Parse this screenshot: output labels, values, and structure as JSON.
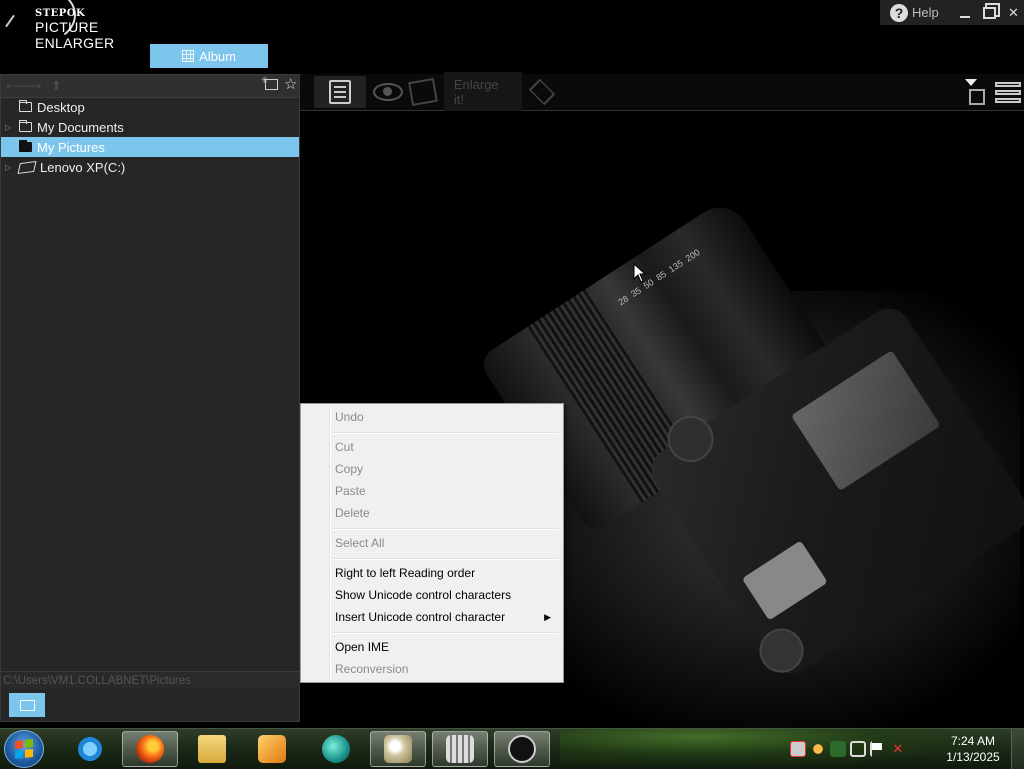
{
  "app": {
    "logo_top": "STEPOK",
    "logo_bottom": "PICTURE ENLARGER",
    "album_label": "Album",
    "help_label": "Help"
  },
  "left_panel": {
    "tree": [
      {
        "label": "Desktop",
        "expandable": false,
        "selected": false,
        "icon": "folder-icon"
      },
      {
        "label": "My Documents",
        "expandable": true,
        "selected": false,
        "icon": "folder-icon"
      },
      {
        "label": "My Pictures",
        "expandable": false,
        "selected": true,
        "icon": "folder-icon"
      },
      {
        "label": "Lenovo XP(C:)",
        "expandable": true,
        "selected": false,
        "icon": "drive-icon"
      }
    ],
    "path": "C:\\Users\\VM1.COLLABNET\\Pictures"
  },
  "toolbar": {
    "enlarge_label": "Enlarge it!"
  },
  "context_menu": {
    "items": [
      {
        "label": "Undo",
        "accel": "U",
        "rest": "ndo",
        "disabled": true
      },
      {
        "label": "Cut",
        "accel": "t",
        "pre": "Cu",
        "disabled": true
      },
      {
        "label": "Copy",
        "accel": "C",
        "rest": "opy",
        "disabled": true
      },
      {
        "label": "Paste",
        "accel": "P",
        "rest": "aste",
        "disabled": true
      },
      {
        "label": "Delete",
        "accel": "D",
        "rest": "elete",
        "disabled": true
      },
      {
        "label": "Select All",
        "accel": "A",
        "pre": "Select ",
        "rest": "ll",
        "disabled": true
      },
      {
        "label": "Right to left Reading order",
        "accel": "R",
        "rest": "ight to left Reading order",
        "disabled": false
      },
      {
        "label": "Show Unicode control characters",
        "accel": "S",
        "rest": "how Unicode control characters",
        "disabled": false
      },
      {
        "label": "Insert Unicode control character",
        "accel": "I",
        "rest": "nsert Unicode control character",
        "disabled": false,
        "submenu": true
      },
      {
        "label": "Open IME",
        "accel": "O",
        "rest": "pen IME",
        "disabled": false
      },
      {
        "label": "Reconversion",
        "accel": "R",
        "rest": "econversion",
        "disabled": true
      }
    ]
  },
  "photo": {
    "lens_numbers": [
      "28",
      "35",
      "50",
      "85",
      "135",
      "200"
    ]
  },
  "taskbar": {
    "apps": [
      {
        "name": "internet-explorer",
        "active": false,
        "color": "#1f86d6"
      },
      {
        "name": "firefox",
        "active": true,
        "color": "#ff7a18"
      },
      {
        "name": "file-explorer",
        "active": false,
        "color": "#e8c54a"
      },
      {
        "name": "media-player",
        "active": false,
        "color": "#f0a020"
      },
      {
        "name": "media-globe",
        "active": false,
        "color": "#29a8a0"
      },
      {
        "name": "paint",
        "active": true,
        "color": "#d0c6a0"
      },
      {
        "name": "picture-grid",
        "active": true,
        "color": "#b0b0b0"
      },
      {
        "name": "stepok-enlarger",
        "active": true,
        "color": "#111111"
      }
    ],
    "time": "7:24 AM",
    "date": "1/13/2025"
  },
  "colors": {
    "accent": "#7cc6ee",
    "background": "#000000",
    "panel": "#262626"
  }
}
